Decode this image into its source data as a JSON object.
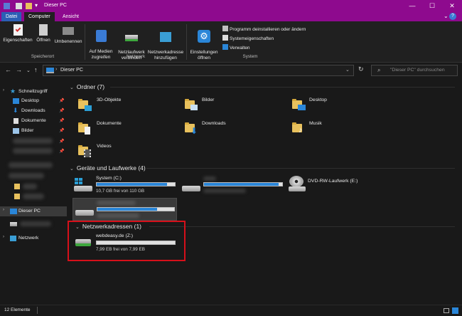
{
  "window": {
    "title": "Dieser PC",
    "minimize": "—",
    "maximize": "☐",
    "close": "✕"
  },
  "ribbon_tabs": [
    "Datei",
    "Computer",
    "Ansicht"
  ],
  "ribbon": {
    "eigenschaften": "Eigenschaften",
    "oeffnen": "Öffnen",
    "umbenennen": "Umbenennen",
    "auf_medien": "Auf Medien\nzugreifen",
    "netzlaufwerk": "Netzlaufwerk\nverbinden",
    "netzwerkadresse": "Netzwerkadresse\nhinzufügen",
    "einstellungen": "Einstellungen\nöffnen",
    "programm": "Programm deinstallieren oder ändern",
    "systemeig": "Systemeigenschaften",
    "verwalten": "Verwalten",
    "grp_speicherort": "Speicherort",
    "grp_netzwerk": "Netzwerk",
    "grp_system": "System"
  },
  "address": {
    "path": "Dieser PC",
    "search_placeholder": "\"Dieser PC\" durchsuchen"
  },
  "nav": {
    "schnellzugriff": "Schnellzugriff",
    "desktop": "Desktop",
    "downloads": "Downloads",
    "dokumente": "Dokumente",
    "bilder": "Bilder",
    "dieser_pc": "Dieser PC",
    "netzwerk": "Netzwerk"
  },
  "folders": {
    "header": "Ordner (7)",
    "items": [
      "3D-Objekte",
      "Bilder",
      "Desktop",
      "Dokumente",
      "Downloads",
      "Musik",
      "Videos"
    ]
  },
  "drives": {
    "header": "Geräte und Laufwerke (4)",
    "system_name": "System (C:)",
    "system_free": "10,7 GB frei von 110 GB",
    "system_fill": 0.9,
    "drive2_fill": 0.95,
    "drive3_fill": 0.78,
    "dvd_name": "DVD-RW-Laufwerk (E:)"
  },
  "network": {
    "header": "Netzwerkadressen (1)",
    "name": "webdeasy.de (Z:)",
    "free": "7,99 EB frei von 7,99 EB",
    "fill": 0.0
  },
  "status": {
    "count": "12 Elemente"
  }
}
